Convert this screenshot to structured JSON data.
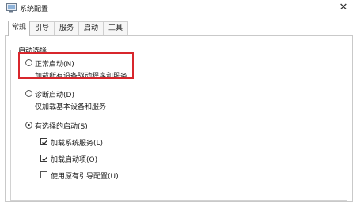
{
  "window": {
    "title": "系统配置",
    "close_glyph": "✕"
  },
  "tabs": [
    {
      "label": "常规",
      "active": true
    },
    {
      "label": "引导",
      "active": false
    },
    {
      "label": "服务",
      "active": false
    },
    {
      "label": "启动",
      "active": false
    },
    {
      "label": "工具",
      "active": false
    }
  ],
  "startup_group": {
    "title": "启动选择",
    "normal": {
      "label": "正常启动(N)",
      "description": "加载所有设备驱动程序和服务",
      "selected": false
    },
    "diagnostic": {
      "label": "诊断启动(D)",
      "description": "仅加载基本设备和服务",
      "selected": false
    },
    "selective": {
      "label": "有选择的启动(S)",
      "selected": true,
      "options": [
        {
          "label": "加载系统服务(L)",
          "checked": true
        },
        {
          "label": "加载启动项(O)",
          "checked": true
        },
        {
          "label": "使用原有引导配置(U)",
          "checked": false
        }
      ]
    }
  },
  "highlight_color": "#d8262c"
}
